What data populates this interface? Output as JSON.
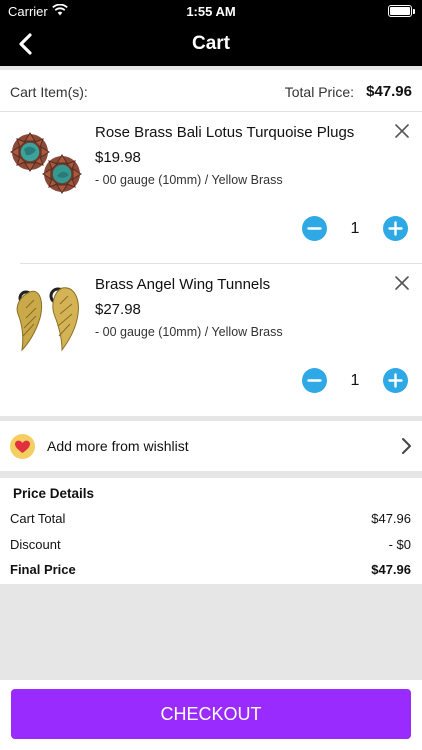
{
  "status_bar": {
    "carrier": "Carrier",
    "time": "1:55 AM"
  },
  "nav": {
    "title": "Cart",
    "back_icon": "chevron-left-icon"
  },
  "summary": {
    "items_label": "Cart Item(s):",
    "total_label": "Total Price:",
    "total_value": "$47.96"
  },
  "cart_items": [
    {
      "name": "Rose Brass Bali Lotus Turquoise Plugs",
      "price": "$19.98",
      "variant": "- 00 gauge (10mm) / Yellow Brass",
      "quantity": "1"
    },
    {
      "name": "Brass Angel Wing Tunnels",
      "price": "$27.98",
      "variant": "- 00 gauge (10mm) / Yellow Brass",
      "quantity": "1"
    }
  ],
  "wishlist": {
    "label": "Add more from wishlist"
  },
  "price_details": {
    "title": "Price Details",
    "rows": [
      {
        "label": "Cart Total",
        "value": "$47.96"
      },
      {
        "label": "Discount",
        "value": "- $0"
      },
      {
        "label": "Final Price",
        "value": "$47.96"
      }
    ]
  },
  "checkout": {
    "label": "CHECKOUT"
  },
  "colors": {
    "accent": "#9a2bff",
    "stepper": "#2ea9e6",
    "header": "#000000",
    "heart": "#e2303f",
    "heart_badge": "#f3cf61"
  }
}
